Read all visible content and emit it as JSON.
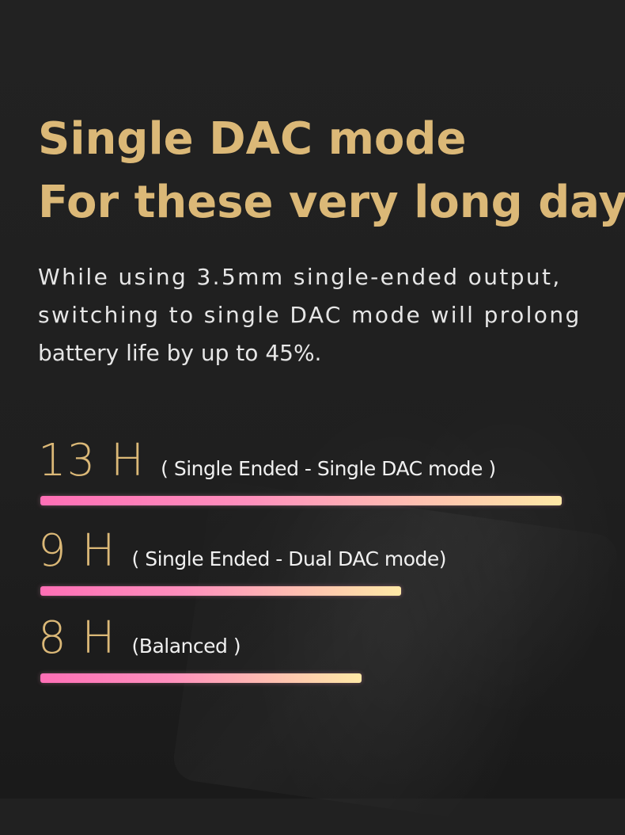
{
  "headline": {
    "line1": "Single DAC mode",
    "line2": "For these very long days"
  },
  "description": {
    "line1": "While using 3.5mm single-ended output,",
    "line2": "switching to single DAC mode will prolong",
    "line3": "battery life by up to 45%."
  },
  "stats": [
    {
      "hours": "13 H",
      "note": "( Single Ended  - Single DAC mode )",
      "bar_fraction": 1.0
    },
    {
      "hours": "9 H",
      "note": "( Single Ended - Dual DAC mode)",
      "bar_fraction": 0.6923
    },
    {
      "hours": "8 H",
      "note": "(Balanced )",
      "bar_fraction": 0.6154
    }
  ],
  "colors": {
    "background": "#212121",
    "accent_gold": "#dbb877",
    "bar_start": "#ff6fb6",
    "bar_end": "#ffe8a6"
  }
}
